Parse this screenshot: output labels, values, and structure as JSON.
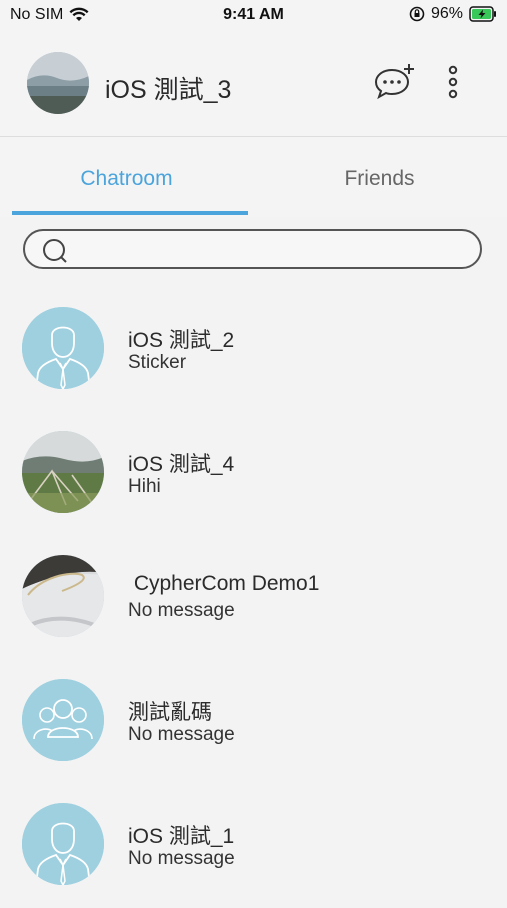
{
  "status_bar": {
    "carrier": "No SIM",
    "time": "9:41 AM",
    "battery": "96%"
  },
  "header": {
    "title": "iOS 測試_3",
    "icons": [
      "new-chat-icon",
      "more-vertical-icon"
    ]
  },
  "tabs": [
    {
      "label": "Chatroom",
      "active": true
    },
    {
      "label": "Friends",
      "active": false
    }
  ],
  "search": {
    "placeholder": "",
    "value": ""
  },
  "chats": [
    {
      "name": "iOS 測試_2",
      "message": "Sticker",
      "avatar": "person-avatar"
    },
    {
      "name": "iOS 測試_4",
      "message": "Hihi",
      "avatar": "landscape-photo"
    },
    {
      "name": " CypherCom Demo1",
      "message": "No message",
      "avatar": "object-photo"
    },
    {
      "name": "測試亂碼",
      "message": "No message",
      "avatar": "group-avatar"
    },
    {
      "name": "iOS 測試_1",
      "message": "No message",
      "avatar": "person-avatar"
    }
  ],
  "colors": {
    "accent": "#4ba4db",
    "avatar_bg": "#9fd0df"
  }
}
